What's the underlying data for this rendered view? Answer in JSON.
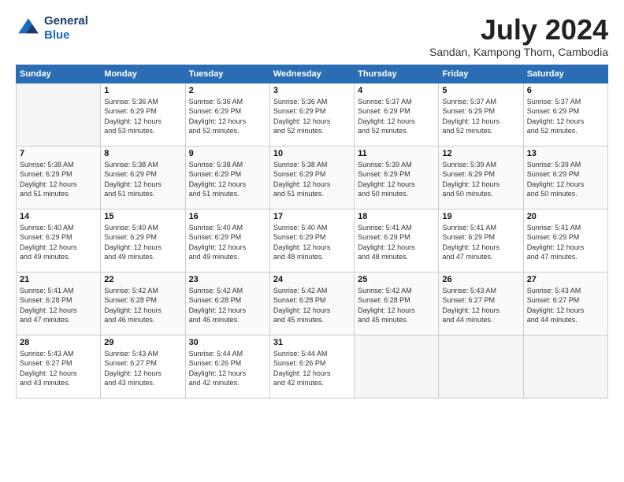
{
  "header": {
    "logo_line1": "General",
    "logo_line2": "Blue",
    "month_title": "July 2024",
    "subtitle": "Sandan, Kampong Thom, Cambodia"
  },
  "weekdays": [
    "Sunday",
    "Monday",
    "Tuesday",
    "Wednesday",
    "Thursday",
    "Friday",
    "Saturday"
  ],
  "weeks": [
    [
      {
        "day": "",
        "info": ""
      },
      {
        "day": "1",
        "info": "Sunrise: 5:36 AM\nSunset: 6:29 PM\nDaylight: 12 hours\nand 53 minutes."
      },
      {
        "day": "2",
        "info": "Sunrise: 5:36 AM\nSunset: 6:29 PM\nDaylight: 12 hours\nand 52 minutes."
      },
      {
        "day": "3",
        "info": "Sunrise: 5:36 AM\nSunset: 6:29 PM\nDaylight: 12 hours\nand 52 minutes."
      },
      {
        "day": "4",
        "info": "Sunrise: 5:37 AM\nSunset: 6:29 PM\nDaylight: 12 hours\nand 52 minutes."
      },
      {
        "day": "5",
        "info": "Sunrise: 5:37 AM\nSunset: 6:29 PM\nDaylight: 12 hours\nand 52 minutes."
      },
      {
        "day": "6",
        "info": "Sunrise: 5:37 AM\nSunset: 6:29 PM\nDaylight: 12 hours\nand 52 minutes."
      }
    ],
    [
      {
        "day": "7",
        "info": "Sunrise: 5:38 AM\nSunset: 6:29 PM\nDaylight: 12 hours\nand 51 minutes."
      },
      {
        "day": "8",
        "info": "Sunrise: 5:38 AM\nSunset: 6:29 PM\nDaylight: 12 hours\nand 51 minutes."
      },
      {
        "day": "9",
        "info": "Sunrise: 5:38 AM\nSunset: 6:29 PM\nDaylight: 12 hours\nand 51 minutes."
      },
      {
        "day": "10",
        "info": "Sunrise: 5:38 AM\nSunset: 6:29 PM\nDaylight: 12 hours\nand 51 minutes."
      },
      {
        "day": "11",
        "info": "Sunrise: 5:39 AM\nSunset: 6:29 PM\nDaylight: 12 hours\nand 50 minutes."
      },
      {
        "day": "12",
        "info": "Sunrise: 5:39 AM\nSunset: 6:29 PM\nDaylight: 12 hours\nand 50 minutes."
      },
      {
        "day": "13",
        "info": "Sunrise: 5:39 AM\nSunset: 6:29 PM\nDaylight: 12 hours\nand 50 minutes."
      }
    ],
    [
      {
        "day": "14",
        "info": "Sunrise: 5:40 AM\nSunset: 6:29 PM\nDaylight: 12 hours\nand 49 minutes."
      },
      {
        "day": "15",
        "info": "Sunrise: 5:40 AM\nSunset: 6:29 PM\nDaylight: 12 hours\nand 49 minutes."
      },
      {
        "day": "16",
        "info": "Sunrise: 5:40 AM\nSunset: 6:29 PM\nDaylight: 12 hours\nand 49 minutes."
      },
      {
        "day": "17",
        "info": "Sunrise: 5:40 AM\nSunset: 6:29 PM\nDaylight: 12 hours\nand 48 minutes."
      },
      {
        "day": "18",
        "info": "Sunrise: 5:41 AM\nSunset: 6:29 PM\nDaylight: 12 hours\nand 48 minutes."
      },
      {
        "day": "19",
        "info": "Sunrise: 5:41 AM\nSunset: 6:29 PM\nDaylight: 12 hours\nand 47 minutes."
      },
      {
        "day": "20",
        "info": "Sunrise: 5:41 AM\nSunset: 6:29 PM\nDaylight: 12 hours\nand 47 minutes."
      }
    ],
    [
      {
        "day": "21",
        "info": "Sunrise: 5:41 AM\nSunset: 6:28 PM\nDaylight: 12 hours\nand 47 minutes."
      },
      {
        "day": "22",
        "info": "Sunrise: 5:42 AM\nSunset: 6:28 PM\nDaylight: 12 hours\nand 46 minutes."
      },
      {
        "day": "23",
        "info": "Sunrise: 5:42 AM\nSunset: 6:28 PM\nDaylight: 12 hours\nand 46 minutes."
      },
      {
        "day": "24",
        "info": "Sunrise: 5:42 AM\nSunset: 6:28 PM\nDaylight: 12 hours\nand 45 minutes."
      },
      {
        "day": "25",
        "info": "Sunrise: 5:42 AM\nSunset: 6:28 PM\nDaylight: 12 hours\nand 45 minutes."
      },
      {
        "day": "26",
        "info": "Sunrise: 5:43 AM\nSunset: 6:27 PM\nDaylight: 12 hours\nand 44 minutes."
      },
      {
        "day": "27",
        "info": "Sunrise: 5:43 AM\nSunset: 6:27 PM\nDaylight: 12 hours\nand 44 minutes."
      }
    ],
    [
      {
        "day": "28",
        "info": "Sunrise: 5:43 AM\nSunset: 6:27 PM\nDaylight: 12 hours\nand 43 minutes."
      },
      {
        "day": "29",
        "info": "Sunrise: 5:43 AM\nSunset: 6:27 PM\nDaylight: 12 hours\nand 43 minutes."
      },
      {
        "day": "30",
        "info": "Sunrise: 5:44 AM\nSunset: 6:26 PM\nDaylight: 12 hours\nand 42 minutes."
      },
      {
        "day": "31",
        "info": "Sunrise: 5:44 AM\nSunset: 6:26 PM\nDaylight: 12 hours\nand 42 minutes."
      },
      {
        "day": "",
        "info": ""
      },
      {
        "day": "",
        "info": ""
      },
      {
        "day": "",
        "info": ""
      }
    ]
  ]
}
